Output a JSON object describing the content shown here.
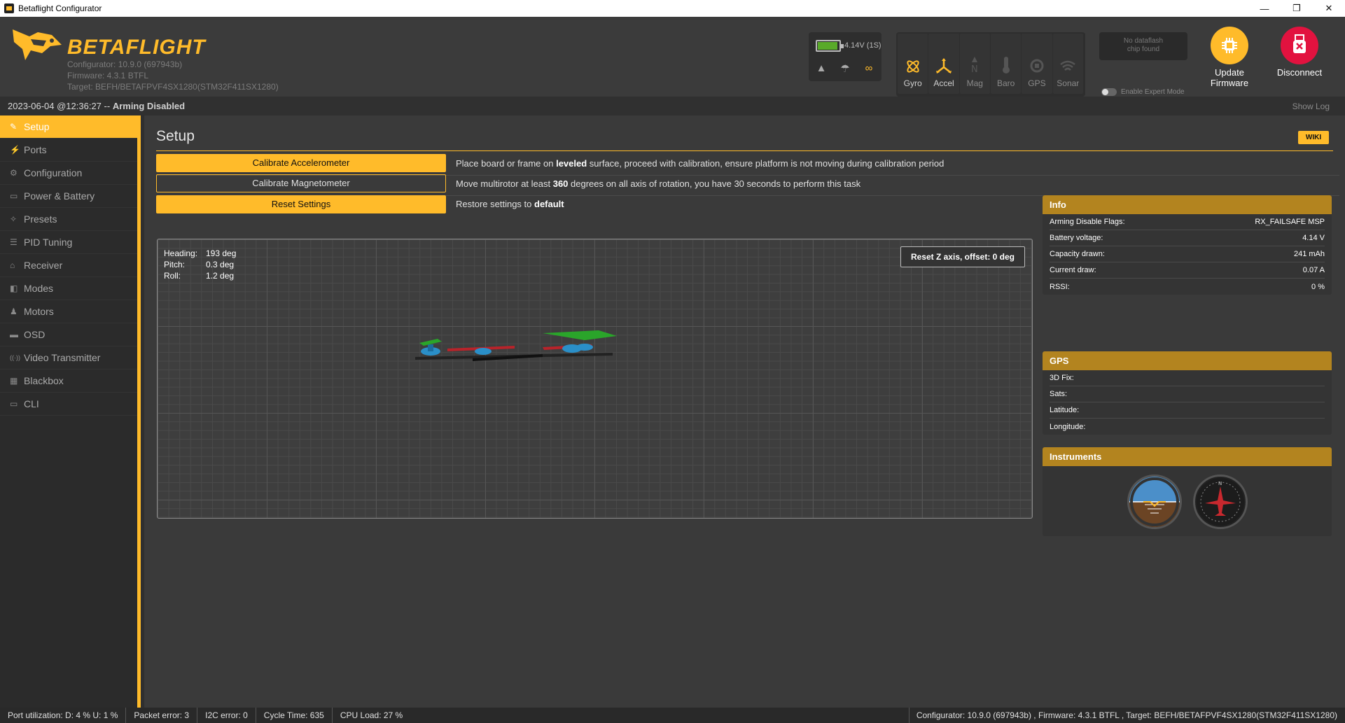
{
  "window": {
    "title": "Betaflight Configurator",
    "minimize": "—",
    "maximize": "❐",
    "close": "✕"
  },
  "header": {
    "logo_text": "BETAFLIGHT",
    "configurator_version": "Configurator: 10.9.0 (697943b)",
    "firmware": "Firmware: 4.3.1 BTFL",
    "target": "Target: BEFH/BETAFPVF4SX1280(STM32F411SX1280)",
    "battery": {
      "text": "4.14V (1S)",
      "level_percent": 100,
      "color": "#59aa29"
    },
    "sensors": [
      {
        "label": "Gyro",
        "active": true
      },
      {
        "label": "Accel",
        "active": true
      },
      {
        "label": "Mag",
        "active": false
      },
      {
        "label": "Baro",
        "active": false
      },
      {
        "label": "GPS",
        "active": false
      },
      {
        "label": "Sonar",
        "active": false
      }
    ],
    "dataflash_line1": "No dataflash",
    "dataflash_line2": "chip found",
    "expert_mode_label": "Enable Expert Mode",
    "update_line1": "Update",
    "update_line2": "Firmware",
    "disconnect": "Disconnect"
  },
  "status_top": {
    "datetime": "2023-06-04 @12:36:27 --",
    "state": "Arming Disabled",
    "show_log": "Show Log"
  },
  "sidebar": {
    "items": [
      {
        "label": "Setup",
        "icon": "wrench-icon",
        "glyph": "✎",
        "active": true
      },
      {
        "label": "Ports",
        "icon": "plug-icon",
        "glyph": "⚡",
        "active": false
      },
      {
        "label": "Configuration",
        "icon": "gear-icon",
        "glyph": "⚙",
        "active": false
      },
      {
        "label": "Power & Battery",
        "icon": "battery-icon",
        "glyph": "▭",
        "active": false
      },
      {
        "label": "Presets",
        "icon": "magic-icon",
        "glyph": "✧",
        "active": false
      },
      {
        "label": "PID Tuning",
        "icon": "sliders-icon",
        "glyph": "☰",
        "active": false
      },
      {
        "label": "Receiver",
        "icon": "receiver-icon",
        "glyph": "⌂",
        "active": false
      },
      {
        "label": "Modes",
        "icon": "modes-icon",
        "glyph": "◧",
        "active": false
      },
      {
        "label": "Motors",
        "icon": "motor-icon",
        "glyph": "♟",
        "active": false
      },
      {
        "label": "OSD",
        "icon": "osd-icon",
        "glyph": "▬",
        "active": false
      },
      {
        "label": "Video Transmitter",
        "icon": "broadcast-icon",
        "glyph": "((·))",
        "active": false
      },
      {
        "label": "Blackbox",
        "icon": "blackbox-icon",
        "glyph": "▦",
        "active": false
      },
      {
        "label": "CLI",
        "icon": "terminal-icon",
        "glyph": "▭",
        "active": false
      }
    ]
  },
  "main": {
    "title": "Setup",
    "wiki": "WIKI",
    "actions": [
      {
        "button": "Calibrate Accelerometer",
        "style": "fill",
        "pre": "Place board or frame on ",
        "bold": "leveled",
        "post": " surface, proceed with calibration, ensure platform is not moving during calibration period"
      },
      {
        "button": "Calibrate Magnetometer",
        "style": "outline",
        "pre": "Move multirotor at least ",
        "bold": "360",
        "post": " degrees on all axis of rotation, you have 30 seconds to perform this task"
      },
      {
        "button": "Reset Settings",
        "style": "fill",
        "pre": "Restore settings to ",
        "bold": "default",
        "post": ""
      }
    ],
    "attitude": {
      "heading_label": "Heading:",
      "heading": "193 deg",
      "pitch_label": "Pitch:",
      "pitch": "0.3 deg",
      "roll_label": "Roll:",
      "roll": "1.2 deg"
    },
    "reset_z": "Reset Z axis, offset: 0 deg"
  },
  "info": {
    "title": "Info",
    "rows": [
      {
        "label": "Arming Disable Flags:",
        "value": "RX_FAILSAFE  MSP"
      },
      {
        "label": "Battery voltage:",
        "value": "4.14 V"
      },
      {
        "label": "Capacity drawn:",
        "value": "241 mAh"
      },
      {
        "label": "Current draw:",
        "value": "0.07 A"
      },
      {
        "label": "RSSI:",
        "value": "0 %"
      }
    ]
  },
  "gps": {
    "title": "GPS",
    "rows": [
      {
        "label": "3D Fix:",
        "value": ""
      },
      {
        "label": "Sats:",
        "value": ""
      },
      {
        "label": "Latitude:",
        "value": ""
      },
      {
        "label": "Longitude:",
        "value": ""
      }
    ]
  },
  "instruments": {
    "title": "Instruments"
  },
  "footer": {
    "port_util": "Port utilization: D: 4 % U: 1 %",
    "packet_error": "Packet error: 3",
    "i2c_error": "I2C error: 0",
    "cycle_time": "Cycle Time: 635",
    "cpu_load": "CPU Load: 27 %",
    "right": "Configurator: 10.9.0 (697943b) , Firmware: 4.3.1 BTFL , Target: BEFH/BETAFPVF4SX1280(STM32F411SX1280)"
  },
  "colors": {
    "accent": "#ffbb2a",
    "disconnect": "#e2123f",
    "battery_ok": "#59aa29"
  }
}
